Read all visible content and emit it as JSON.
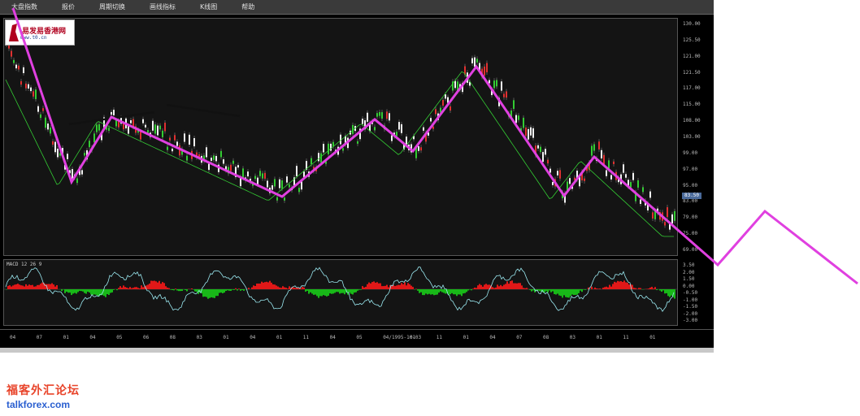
{
  "menubar": {
    "items": [
      "大盘指数",
      "报价",
      "周期切换",
      "画线指标",
      "K线图",
      "帮助"
    ]
  },
  "logo": {
    "text": "易发易香港网",
    "url": "www.t0.cn"
  },
  "indicator": {
    "title": "MACD 12 26 9"
  },
  "price_axis": {
    "ticks": [
      "130.00",
      "125.50",
      "121.00",
      "121.50",
      "117.00",
      "115.00",
      "108.00",
      "103.00",
      "99.00",
      "97.00",
      "95.00",
      "83.00",
      "79.00",
      "75.00",
      "69.00"
    ]
  },
  "indicator_axis": {
    "ticks": [
      "3.50",
      "2.00",
      "1.50",
      "0.00",
      "-0.50",
      "-1.00",
      "-1.50",
      "-2.00",
      "-3.00"
    ]
  },
  "last_price": "83.50",
  "time_axis": {
    "ticks": [
      "04",
      "07",
      "01",
      "04",
      "05",
      "06",
      "08",
      "03",
      "01",
      "04",
      "01",
      "11",
      "04",
      "05",
      "04/1995-10-03",
      "01",
      "11",
      "01",
      "04",
      "07",
      "08",
      "03",
      "01",
      "11",
      "01"
    ]
  },
  "watermark": {
    "cn": "福客外汇论坛",
    "en": "talkforex.com"
  },
  "colors": {
    "overlay_line": "#e040e0",
    "macd_positive": "#e01818",
    "macd_negative": "#18b818",
    "signal_line": "#9ae8f0",
    "moving_average": "#33cc33",
    "trend_line": "#111111"
  }
}
